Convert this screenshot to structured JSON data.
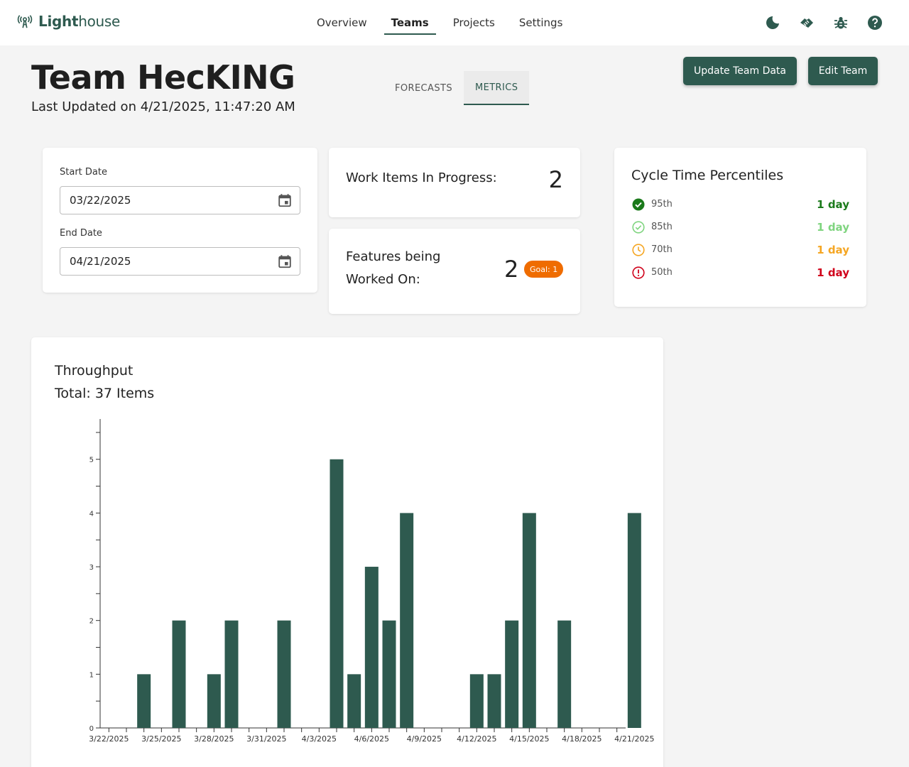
{
  "app": {
    "name_bold_part": "Light",
    "name_rest": "house"
  },
  "nav": {
    "items": [
      {
        "label": "Overview"
      },
      {
        "label": "Teams"
      },
      {
        "label": "Projects"
      },
      {
        "label": "Settings"
      }
    ],
    "active": "Teams",
    "icons": [
      "dark-mode-moon-icon",
      "support-handshake-icon",
      "bug-report-icon",
      "help-icon"
    ]
  },
  "header": {
    "team_name": "Team HecKING",
    "last_updated": "Last Updated on 4/21/2025, 11:47:20 AM",
    "tabs": [
      {
        "label": "FORECASTS"
      },
      {
        "label": "METRICS"
      }
    ],
    "active_tab": "METRICS",
    "update_button": "Update Team Data",
    "edit_button": "Edit Team"
  },
  "dates": {
    "start_label": "Start Date",
    "start_value": "03/22/2025",
    "end_label": "End Date",
    "end_value": "04/21/2025"
  },
  "wip": {
    "label": "Work Items In Progress:",
    "value": "2"
  },
  "features": {
    "label": "Features being Worked On:",
    "value": "2",
    "goal": "Goal: 1"
  },
  "percentiles": {
    "title": "Cycle Time Percentiles",
    "rows": [
      {
        "name": "95th",
        "value": "1 day",
        "color": "#1b7a1b",
        "icon": "check-circle-filled-icon"
      },
      {
        "name": "85th",
        "value": "1 day",
        "color": "#7fd47f",
        "icon": "check-circle-outline-icon"
      },
      {
        "name": "70th",
        "value": "1 day",
        "color": "#f5a623",
        "icon": "clock-icon"
      },
      {
        "name": "50th",
        "value": "1 day",
        "color": "#d0021b",
        "icon": "error-circle-icon"
      }
    ]
  },
  "throughput": {
    "title": "Throughput",
    "total": "Total: 37 Items"
  },
  "colors": {
    "accent": "#2e5a4f",
    "goal_badge": "#ef6c00"
  },
  "chart_data": {
    "type": "bar",
    "categories": [
      "3/22/2025",
      "3/23/2025",
      "3/24/2025",
      "3/25/2025",
      "3/26/2025",
      "3/27/2025",
      "3/28/2025",
      "3/29/2025",
      "3/30/2025",
      "3/31/2025",
      "4/1/2025",
      "4/2/2025",
      "4/3/2025",
      "4/4/2025",
      "4/5/2025",
      "4/6/2025",
      "4/7/2025",
      "4/8/2025",
      "4/9/2025",
      "4/10/2025",
      "4/11/2025",
      "4/12/2025",
      "4/13/2025",
      "4/14/2025",
      "4/15/2025",
      "4/16/2025",
      "4/17/2025",
      "4/18/2025",
      "4/19/2025",
      "4/20/2025",
      "4/21/2025"
    ],
    "x_tick_labels": [
      "3/22/2025",
      "3/25/2025",
      "3/28/2025",
      "3/31/2025",
      "4/3/2025",
      "4/6/2025",
      "4/9/2025",
      "4/12/2025",
      "4/15/2025",
      "4/18/2025",
      "4/21/2025"
    ],
    "values": [
      0,
      0,
      1,
      0,
      2,
      0,
      1,
      2,
      0,
      0,
      2,
      0,
      0,
      5,
      1,
      3,
      2,
      4,
      0,
      0,
      0,
      1,
      1,
      2,
      4,
      0,
      2,
      0,
      0,
      0,
      4
    ],
    "y_ticks": [
      0,
      1,
      2,
      3,
      4,
      5
    ],
    "ylim": [
      0,
      5.75
    ],
    "bar_color": "#2e5a4f",
    "title": "Throughput",
    "xlabel": "",
    "ylabel": ""
  }
}
